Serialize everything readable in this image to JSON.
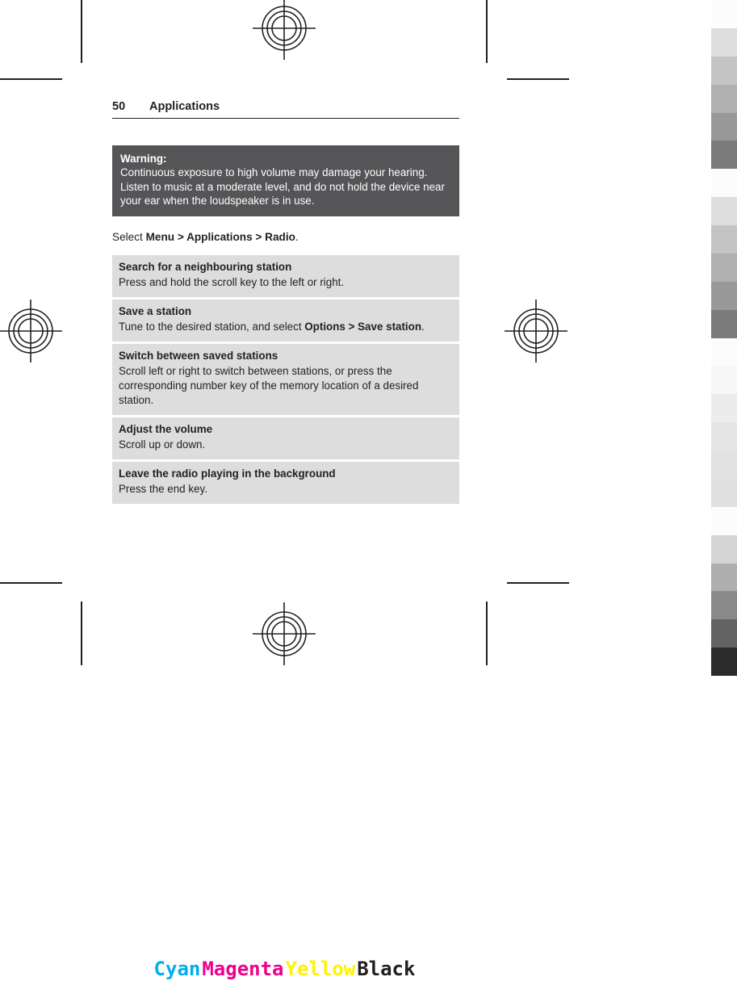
{
  "header": {
    "page_number": "50",
    "section_title": "Applications"
  },
  "warning": {
    "label": "Warning:",
    "text": "Continuous exposure to high volume may damage your hearing. Listen to music at a moderate level, and do not hold the device near your ear when the loudspeaker is in use.",
    "background": "#555558",
    "text_color": "#ffffff"
  },
  "select_path": {
    "lead": "Select ",
    "item1": "Menu",
    "separator1": " > ",
    "item2": "Applications",
    "separator2": " > ",
    "item3": "Radio",
    "trailing": "."
  },
  "task_table": {
    "row_background": "#dddddd",
    "rows": [
      {
        "title": "Search for a neighbouring station",
        "desc": "Press and hold the scroll key to the left or right."
      },
      {
        "title": "Save a station",
        "desc_prefix": "Tune to the desired station, and select ",
        "desc_bold1": "Options",
        "desc_sep": " > ",
        "desc_bold2": "Save station",
        "desc_suffix": "."
      },
      {
        "title": "Switch between saved stations",
        "desc": "Scroll left or right to switch between stations, or press the corresponding number key of the memory location of a desired station."
      },
      {
        "title": "Adjust the volume",
        "desc": "Scroll up or down."
      },
      {
        "title": "Leave the radio playing in the background",
        "desc": "Press the end key."
      }
    ]
  },
  "cmyk_legend": {
    "cyan": "Cyan",
    "magenta": "Magenta",
    "yellow": "Yellow",
    "black": "Black",
    "cyan_color": "#00aeef",
    "magenta_color": "#ec008c",
    "yellow_color": "#fff200",
    "black_color": "#231f20"
  },
  "calibration_strip": {
    "steps": [
      "#fcfcfc",
      "#dedede",
      "#c4c4c4",
      "#b0b0b0",
      "#999999",
      "#7b7b7b",
      "#fcfcfc",
      "#dedede",
      "#c4c4c4",
      "#b0b0b0",
      "#999999",
      "#7b7b7b",
      "#fcfcfc",
      "#f7f7f7",
      "#ececec",
      "#e5e5e5",
      "#e2e2e2",
      "#e0e0e0",
      "#fcfcfc",
      "#d4d4d4",
      "#aeaeae",
      "#8a8a8a",
      "#636363",
      "#2b2b2b"
    ]
  },
  "print_marks": {
    "registration_label": "registration-target",
    "crop_label": "crop-mark"
  }
}
